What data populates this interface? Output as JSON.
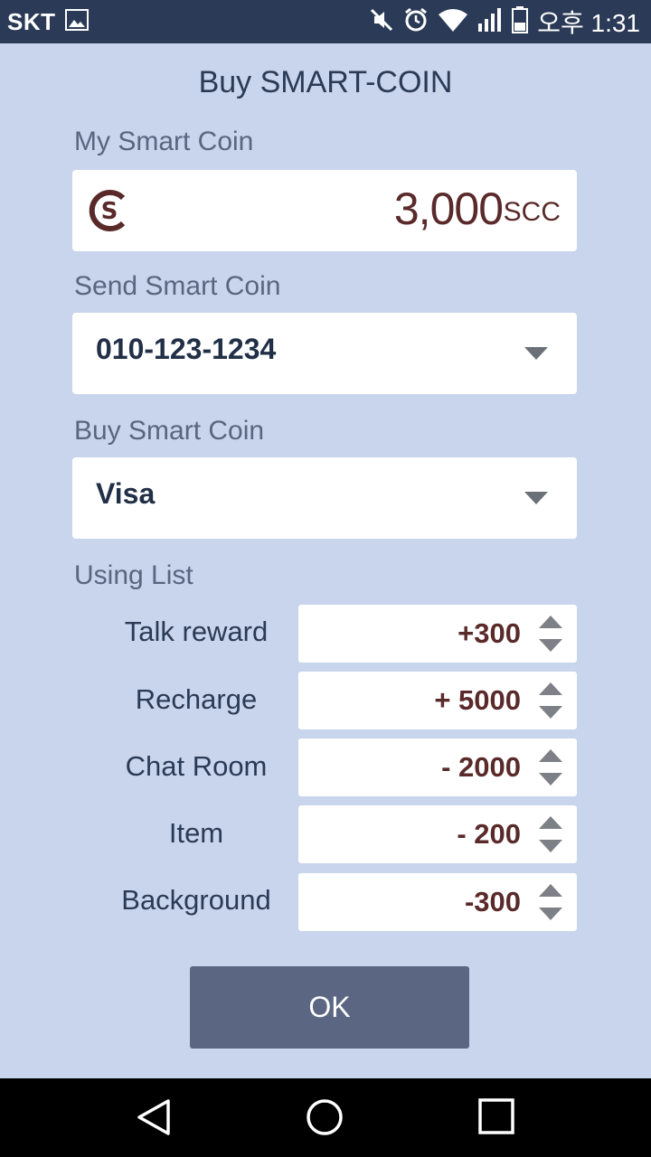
{
  "status_bar": {
    "carrier": "SKT",
    "time": "오후 1:31",
    "icons": [
      "gallery-icon",
      "mute-icon",
      "alarm-icon",
      "wifi-icon",
      "signal-icon",
      "battery-icon"
    ]
  },
  "title": "Buy SMART-COIN",
  "my_coin": {
    "label": "My  Smart Coin",
    "value": "3,000",
    "unit": "SCC"
  },
  "send": {
    "label": "Send Smart Coin",
    "selected": "010-123-1234"
  },
  "buy": {
    "label": "Buy Smart Coin",
    "selected": "Visa"
  },
  "using_list": {
    "label": "Using List",
    "items": [
      {
        "label": "Talk  reward",
        "value": "+300"
      },
      {
        "label": "Recharge",
        "value": "+ 5000"
      },
      {
        "label": "Chat Room",
        "value": "- 2000"
      },
      {
        "label": "Item",
        "value": "- 200"
      },
      {
        "label": "Background",
        "value": "-300"
      }
    ]
  },
  "ok_label": "OK",
  "colors": {
    "background": "#c9d5ed",
    "status_bar": "#2a3a57",
    "accent_value": "#5a2a2a",
    "button": "#5b6682"
  }
}
